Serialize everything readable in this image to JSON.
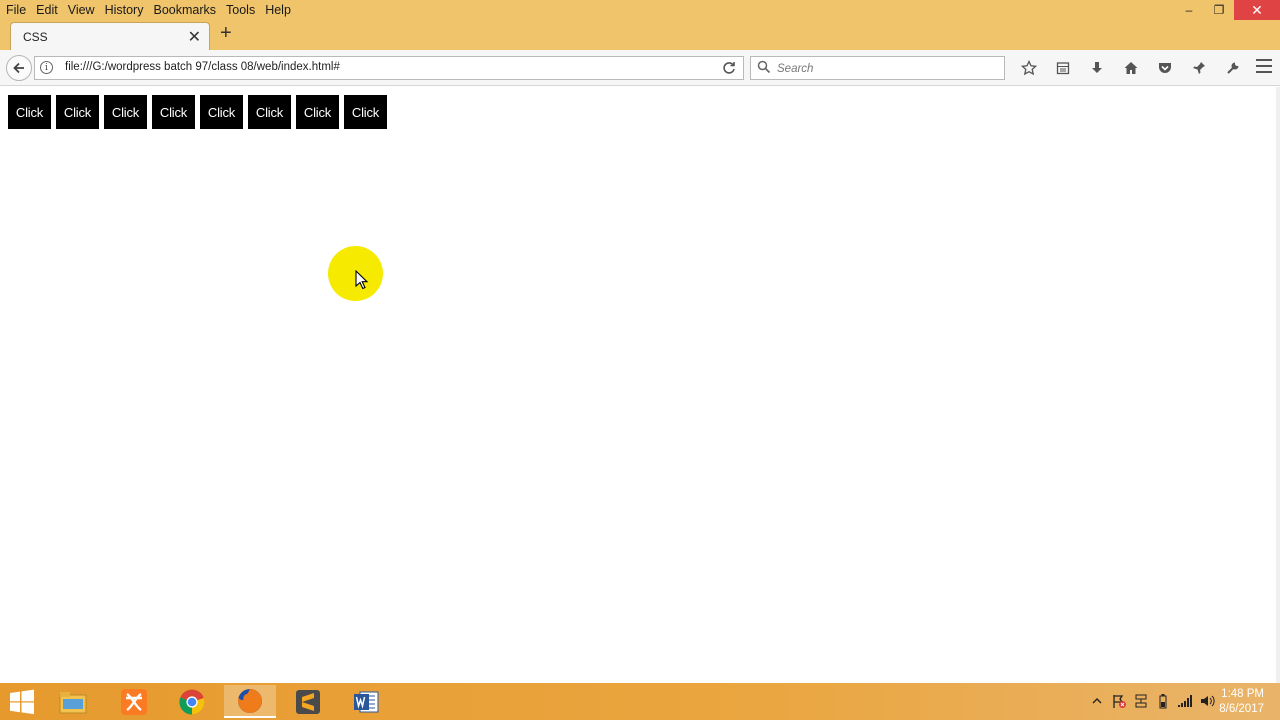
{
  "menubar": {
    "items": [
      "File",
      "Edit",
      "View",
      "History",
      "Bookmarks",
      "Tools",
      "Help"
    ],
    "window_controls": {
      "minimize": "–",
      "restore": "❐",
      "close": "✕"
    }
  },
  "tabs": [
    {
      "title": "CSS",
      "close": "✕"
    }
  ],
  "newtab_label": "+",
  "navbar": {
    "url": "file:///G:/wordpress batch 97/class 08/web/index.html#",
    "search_placeholder": "Search"
  },
  "page": {
    "buttons": [
      "Click",
      "Click",
      "Click",
      "Click",
      "Click",
      "Click",
      "Click",
      "Click"
    ]
  },
  "taskbar": {
    "apps": [
      "windows-start",
      "file-explorer",
      "xampp",
      "chrome",
      "firefox",
      "sublime-text",
      "word"
    ],
    "time": "1:48 PM",
    "date": "8/6/2017"
  },
  "colors": {
    "titlebar": "#f0c46a",
    "button_bg": "#000000",
    "button_text": "#ffffff",
    "cursor_highlight": "#f6ea00",
    "close_red": "#e04343"
  }
}
